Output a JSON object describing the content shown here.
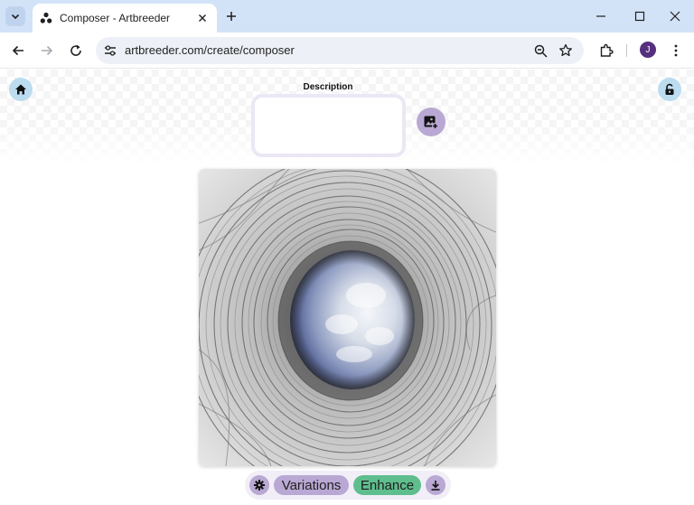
{
  "browser": {
    "tab_title": "Composer - Artbreeder",
    "url": "artbreeder.com/create/composer",
    "profile_initial": "J"
  },
  "page": {
    "description_label": "Description",
    "description_value": "",
    "buttons": {
      "variations": "Variations",
      "enhance": "Enhance"
    }
  },
  "colors": {
    "accent_purple": "#b9a8d3",
    "enhance_green": "#5fbe8d",
    "corner_blue": "#bcdcf0",
    "tabstrip": "#d3e3f7"
  },
  "icons": {
    "home": "home-icon",
    "lock": "unlock-icon",
    "add_image": "add-image-icon",
    "settings": "gear-icon",
    "download": "download-icon"
  }
}
